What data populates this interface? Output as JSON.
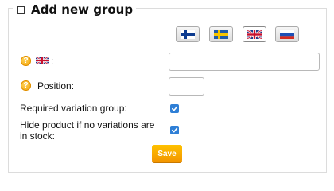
{
  "group": {
    "title": "Add new group",
    "language_flags": [
      {
        "icon": "finland-flag-icon"
      },
      {
        "icon": "sweden-flag-icon"
      },
      {
        "icon": "uk-flag-icon",
        "selected": true
      },
      {
        "icon": "russia-flag-icon"
      }
    ],
    "name_field": {
      "label": ":",
      "value": "",
      "placeholder": ""
    },
    "position_field": {
      "label": "Position:",
      "value": ""
    },
    "required_variation": {
      "label": "Required variation group:",
      "checked": true
    },
    "hide_product": {
      "label_line1": "Hide product if no variations are",
      "label_line2": "in stock:",
      "checked": true
    },
    "save_label": "Save"
  },
  "colors": {
    "accent_orange": "#f5a300",
    "checkbox_blue": "#2f7fd6"
  }
}
